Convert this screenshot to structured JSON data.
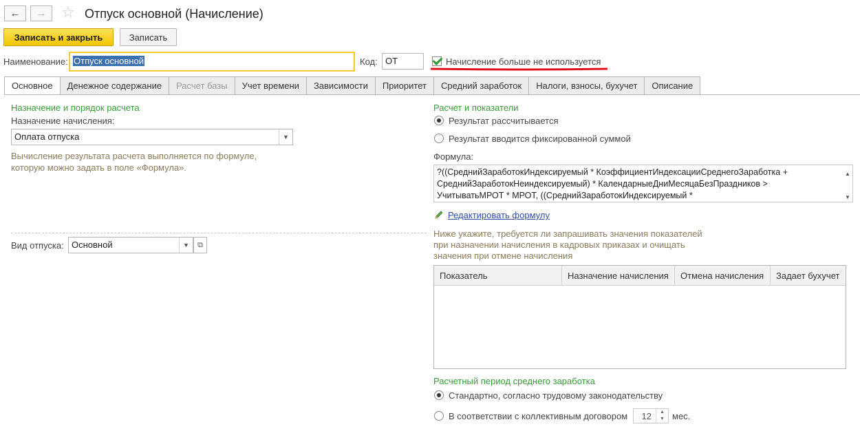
{
  "window": {
    "title": "Отпуск основной (Начисление)"
  },
  "nav": {
    "back_icon": "←",
    "forward_icon": "→",
    "star_icon": "☆"
  },
  "toolbar": {
    "save_close_label": "Записать и закрыть",
    "save_label": "Записать"
  },
  "header": {
    "name_label": "Наименование:",
    "name_value": "Отпуск основной",
    "code_label": "Код:",
    "code_value": "ОТ",
    "unused_label": "Начисление больше не используется",
    "unused_checked": true,
    "highlight_color": "#e0101a"
  },
  "tabs": [
    {
      "label": "Основное"
    },
    {
      "label": "Денежное содержание"
    },
    {
      "label": "Расчет базы"
    },
    {
      "label": "Учет времени"
    },
    {
      "label": "Зависимости"
    },
    {
      "label": "Приоритет"
    },
    {
      "label": "Средний заработок"
    },
    {
      "label": "Налоги, взносы, бухучет"
    },
    {
      "label": "Описание"
    }
  ],
  "left": {
    "section_title": "Назначение и порядок расчета",
    "purpose_label": "Назначение начисления:",
    "purpose_value": "Оплата отпуска",
    "hint_line1": "Вычисление результата расчета выполняется по формуле,",
    "hint_line2": "которую можно задать в поле «Формула».",
    "vacation_label": "Вид отпуска:",
    "vacation_value": "Основной"
  },
  "right": {
    "section_title": "Расчет и показатели",
    "radio_calculated": "Результат рассчитывается",
    "radio_fixed": "Результат вводится фиксированной суммой",
    "formula_label": "Формула:",
    "formula_line1": "?((СреднийЗаработокИндексируемый * КоэффициентИндексацииСреднегоЗаработка +",
    "formula_line2": "СреднийЗаработокНеиндексируемый) * КалендарныеДниМесяцаБезПраздников >",
    "formula_line3": "УчитыватьМРОТ * МРОТ, ((СреднийЗаработокИндексируемый *",
    "edit_formula_link": "Редактировать формулу",
    "indicators_hint_line1": "Ниже укажите, требуется ли запрашивать значения показателей",
    "indicators_hint_line2": "при назначении начисления в кадровых приказах и очищать",
    "indicators_hint_line3": "значения при отмене начисления",
    "grid_columns": [
      "Показатель",
      "Назначение начисления",
      "Отмена начисления",
      "Задает бухучет"
    ],
    "avg_section_title": "Расчетный период среднего заработка",
    "radio_standard": "Стандартно, согласно трудовому законодательству",
    "radio_collective": "В соответствии с коллективным договором",
    "months_value": "12",
    "months_unit": "мес."
  }
}
